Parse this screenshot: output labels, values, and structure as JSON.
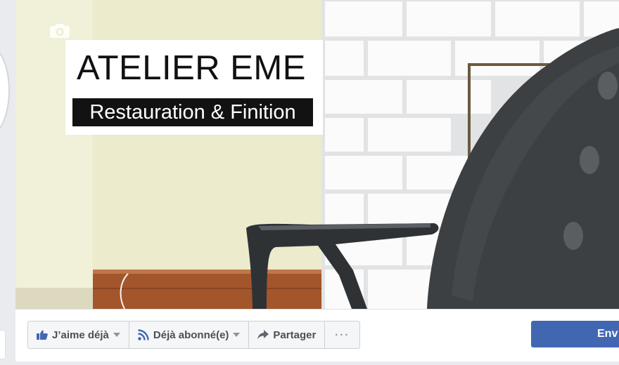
{
  "logo": {
    "title": "ATELIER EME",
    "subtitle": "Restauration & Finition"
  },
  "actions": {
    "like_label": "J’aime déjà",
    "follow_label": "Déjà abonné(e)",
    "share_label": "Partager",
    "more_label": "···",
    "send_label": "Env"
  },
  "icons": {
    "camera": "camera-icon",
    "like": "thumbs-up-icon",
    "follow": "rss-icon",
    "share": "share-arrow-icon",
    "caret": "caret-down-icon"
  },
  "colors": {
    "brand_blue": "#4267b2",
    "like_blue": "#4267b2",
    "bar_bg": "#f5f6f7"
  }
}
